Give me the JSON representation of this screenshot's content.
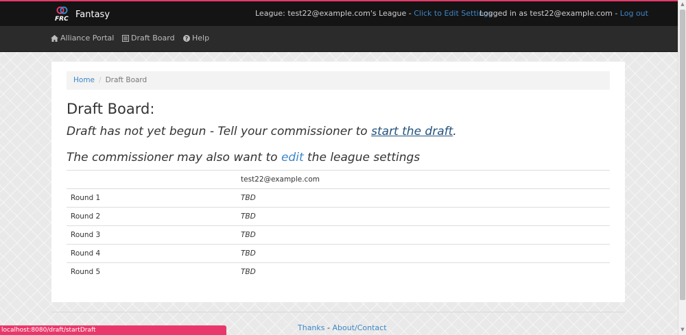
{
  "brand": {
    "name": "Fantasy",
    "logo_text": "FRC"
  },
  "header": {
    "league_prefix": "League: test22@example.com's League - ",
    "edit_settings": "Click to Edit Settings",
    "logged_in_prefix": "Logged in as test22@example.com - ",
    "logout": "Log out"
  },
  "nav": {
    "items": [
      {
        "label": "Alliance Portal",
        "icon": "home-icon"
      },
      {
        "label": "Draft Board",
        "icon": "list-icon"
      },
      {
        "label": "Help",
        "icon": "question-circle-icon"
      }
    ]
  },
  "breadcrumb": {
    "home": "Home",
    "separator": "/",
    "current": "Draft Board"
  },
  "page": {
    "title": "Draft Board:",
    "msg1_prefix": "Draft has not yet begun - Tell your commissioner to ",
    "msg1_link": "start the draft",
    "msg1_suffix": ".",
    "msg2_prefix": "The commissioner may also want to ",
    "msg2_link": "edit",
    "msg2_suffix": " the league settings"
  },
  "table": {
    "header": [
      "",
      "test22@example.com"
    ],
    "rows": [
      {
        "round": "Round 1",
        "pick": "TBD"
      },
      {
        "round": "Round 2",
        "pick": "TBD"
      },
      {
        "round": "Round 3",
        "pick": "TBD"
      },
      {
        "round": "Round 4",
        "pick": "TBD"
      },
      {
        "round": "Round 5",
        "pick": "TBD"
      }
    ]
  },
  "footer": {
    "thanks": "Thanks",
    "separator": " - ",
    "about": "About/Contact"
  },
  "status_bar": {
    "url": "localhost:8080/draft/startDraft"
  },
  "colors": {
    "accent": "#e8386b",
    "link": "#3d86c6",
    "topbar": "#141414",
    "navbar": "#2b2b2b"
  }
}
